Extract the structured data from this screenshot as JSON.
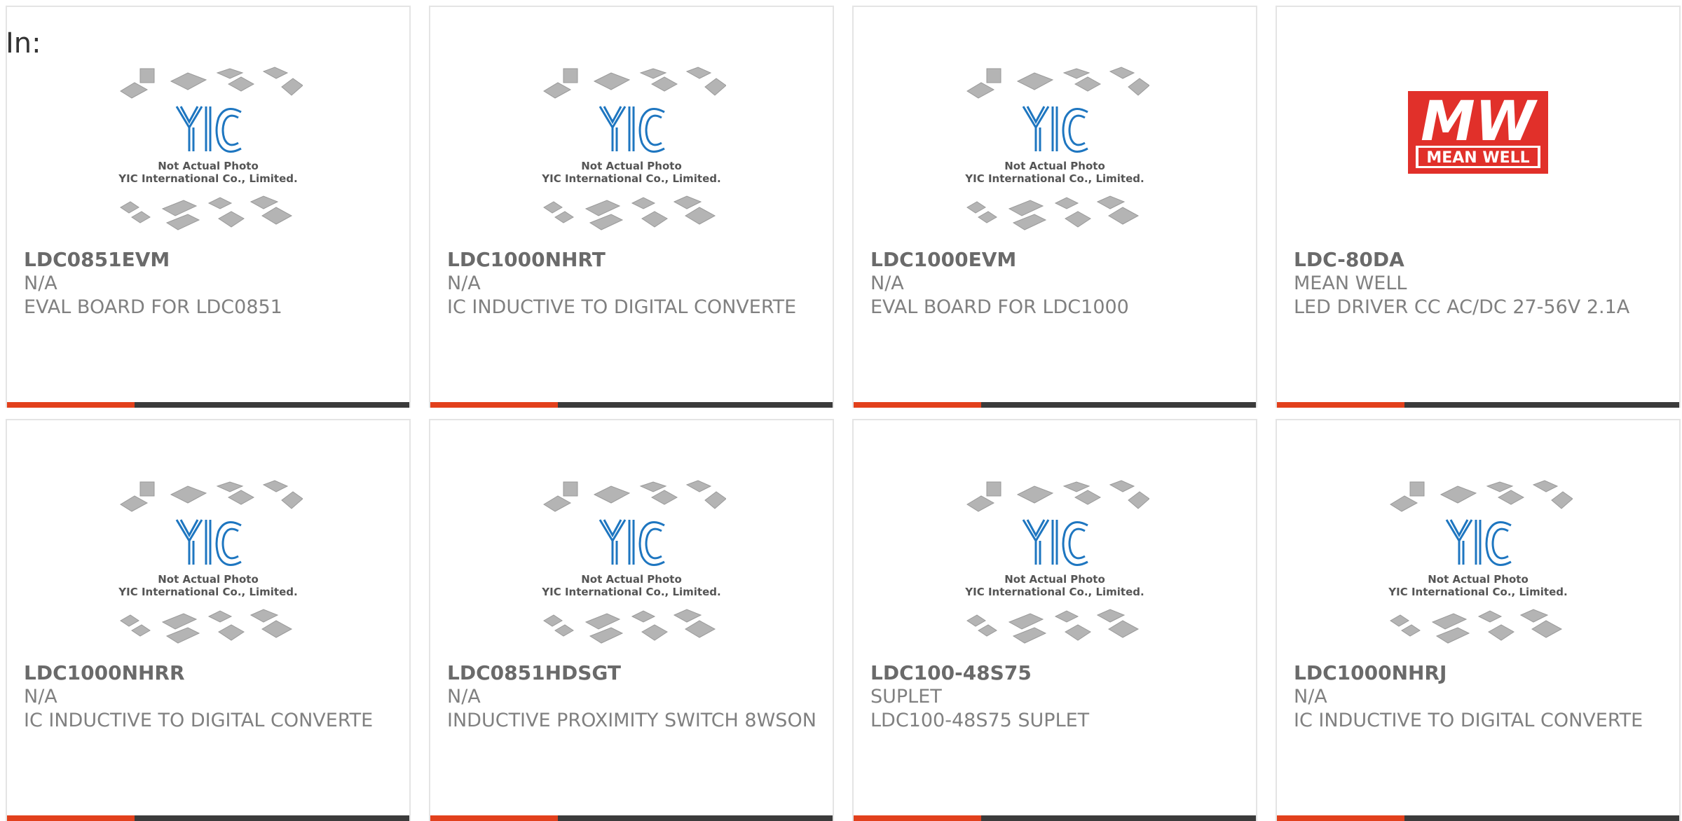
{
  "page": {
    "prefix_label": "In:"
  },
  "placeholder": {
    "line1": "Not Actual Photo",
    "line2": "YIC International Co., Limited."
  },
  "colors": {
    "accent": "#e2401c",
    "bar": "#3b3b3b",
    "yic_blue": "#1e76c0",
    "meanwell_red": "#e1302a"
  },
  "products": [
    {
      "part": "LDC0851EVM",
      "maker": "N/A",
      "desc": "EVAL BOARD FOR LDC0851",
      "image": "yic-placeholder"
    },
    {
      "part": "LDC1000NHRT",
      "maker": "N/A",
      "desc": "IC INDUCTIVE TO DIGITAL CONVERTE",
      "image": "yic-placeholder"
    },
    {
      "part": "LDC1000EVM",
      "maker": "N/A",
      "desc": "EVAL BOARD FOR LDC1000",
      "image": "yic-placeholder"
    },
    {
      "part": "LDC-80DA",
      "maker": "MEAN WELL",
      "desc": "LED DRIVER CC AC/DC 27-56V 2.1A",
      "image": "meanwell-logo",
      "logo_text": "MEAN WELL",
      "logo_mark": "MW"
    },
    {
      "part": "LDC1000NHRR",
      "maker": "N/A",
      "desc": "IC INDUCTIVE TO DIGITAL CONVERTE",
      "image": "yic-placeholder"
    },
    {
      "part": "LDC0851HDSGT",
      "maker": "N/A",
      "desc": "INDUCTIVE PROXIMITY SWITCH 8WSON",
      "image": "yic-placeholder"
    },
    {
      "part": "LDC100-48S75",
      "maker": "SUPLET",
      "desc": "LDC100-48S75 SUPLET",
      "image": "yic-placeholder"
    },
    {
      "part": "LDC1000NHRJ",
      "maker": "N/A",
      "desc": "IC INDUCTIVE TO DIGITAL CONVERTE",
      "image": "yic-placeholder"
    }
  ]
}
